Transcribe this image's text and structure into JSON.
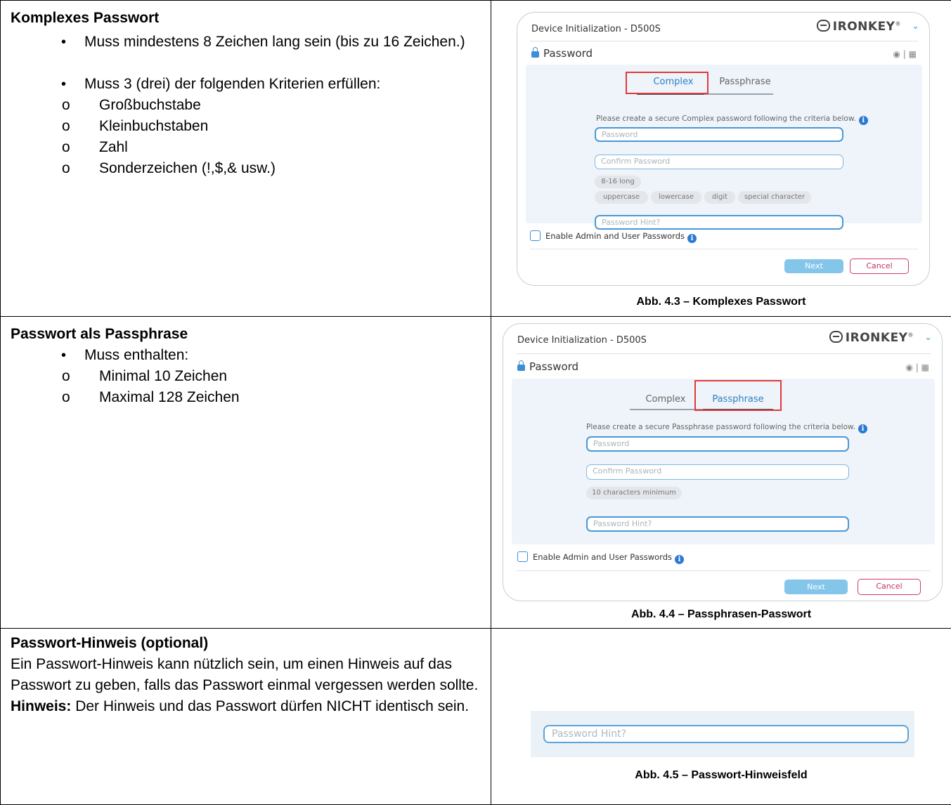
{
  "row1": {
    "heading": "Komplexes Passwort",
    "bullets": [
      {
        "text": "Muss mindestens 8 Zeichen lang sein (bis zu 16 Zeichen.)"
      },
      {
        "text": "Muss 3 (drei) der folgenden Kriterien erfüllen:"
      }
    ],
    "criteria": [
      "Großbuchstabe",
      "Kleinbuchstaben",
      "Zahl",
      "Sonderzeichen (!,$,& usw.)"
    ],
    "caption": "Abb. 4.3 – Komplexes Passwort",
    "dialog": {
      "title": "Device Initialization - D500S",
      "brand": "IRONKEY",
      "brand_mark": "®",
      "section": "Password",
      "tab_complex": "Complex",
      "tab_passphrase": "Passphrase",
      "active_tab": "Complex",
      "instruction": "Please create a secure Complex password following the criteria below.",
      "password_placeholder": "Password",
      "confirm_placeholder": "Confirm Password",
      "chip_length": "8-16 long",
      "chips": [
        "uppercase",
        "lowercase",
        "digit",
        "special character"
      ],
      "hint_placeholder": "Password Hint?",
      "checkbox_label": "Enable Admin and User Passwords",
      "next_label": "Next",
      "cancel_label": "Cancel"
    }
  },
  "row2": {
    "heading": "Passwort als Passphrase",
    "bullet": "Muss enthalten:",
    "items": [
      "Minimal 10 Zeichen",
      "Maximal 128 Zeichen"
    ],
    "caption": "Abb. 4.4 – Passphrasen-Passwort",
    "dialog": {
      "title": "Device Initialization - D500S",
      "brand": "IRONKEY",
      "brand_mark": "®",
      "section": "Password",
      "tab_complex": "Complex",
      "tab_passphrase": "Passphrase",
      "active_tab": "Passphrase",
      "instruction": "Please create a secure Passphrase password following the criteria below.",
      "password_placeholder": "Password",
      "confirm_placeholder": "Confirm Password",
      "chip_length": "10 characters minimum",
      "hint_placeholder": "Password Hint?",
      "checkbox_label": "Enable Admin and User Passwords",
      "next_label": "Next",
      "cancel_label": "Cancel"
    }
  },
  "row3": {
    "heading": "Passwort-Hinweis (optional)",
    "paragraph": "Ein Passwort-Hinweis kann nützlich sein, um einen Hinweis auf das Passwort zu geben, falls das Passwort einmal vergessen werden sollte.",
    "note_lead": "Hinweis:",
    "note_text": " Der Hinweis und das Passwort dürfen NICHT identisch sein.",
    "hint_placeholder": "Password Hint?",
    "caption": "Abb. 4.5 – Passwort-Hinweisfeld"
  },
  "colors": {
    "accent": "#2e7fc4",
    "highlight_box": "#e03a3a",
    "cancel": "#d2386a",
    "next": "#84c6ea"
  }
}
